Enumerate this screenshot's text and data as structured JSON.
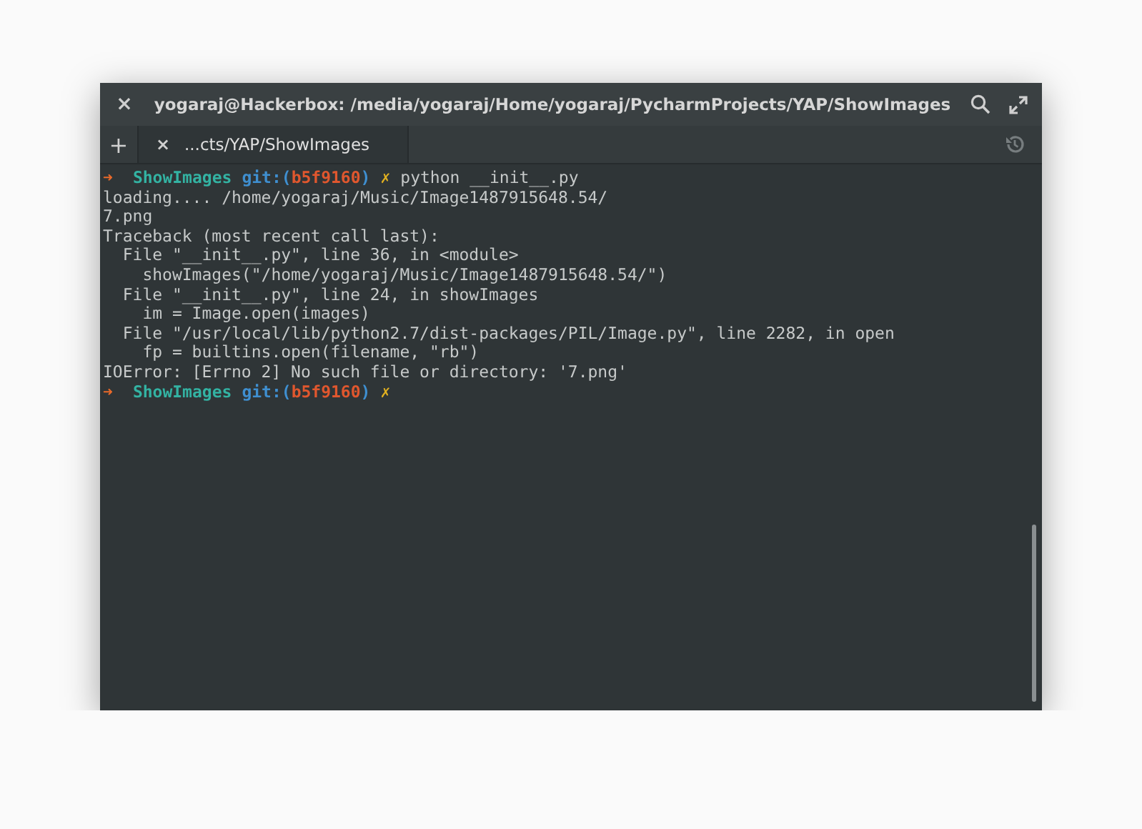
{
  "window": {
    "title": "yogaraj@Hackerbox: /media/yogaraj/Home/yogaraj/PycharmProjects/YAP/ShowImages",
    "close": "×"
  },
  "tabs": [
    {
      "label": "...cts/YAP/ShowImages",
      "close": "×",
      "selected": true
    }
  ],
  "new_tab": "+",
  "terminal": {
    "lines": [
      {
        "kind": "prompt",
        "arrow": "➜",
        "dir": "ShowImages",
        "git": "git:(",
        "branch": "b5f9160",
        "git_end": ")",
        "dirty": "✗",
        "command": "python __init__.py"
      },
      {
        "kind": "output",
        "text": "loading.... /home/yogaraj/Music/Image1487915648.54/"
      },
      {
        "kind": "output",
        "text": "7.png"
      },
      {
        "kind": "output",
        "text": "Traceback (most recent call last):"
      },
      {
        "kind": "output",
        "text": "  File \"__init__.py\", line 36, in <module>"
      },
      {
        "kind": "output",
        "text": "    showImages(\"/home/yogaraj/Music/Image1487915648.54/\")"
      },
      {
        "kind": "output",
        "text": "  File \"__init__.py\", line 24, in showImages"
      },
      {
        "kind": "output",
        "text": "    im = Image.open(images)"
      },
      {
        "kind": "output",
        "text": "  File \"/usr/local/lib/python2.7/dist-packages/PIL/Image.py\", line 2282, in open"
      },
      {
        "kind": "output",
        "text": "    fp = builtins.open(filename, \"rb\")"
      },
      {
        "kind": "output",
        "text": "IOError: [Errno 2] No such file or directory: '7.png'"
      },
      {
        "kind": "prompt",
        "arrow": "➜",
        "dir": "ShowImages",
        "git": "git:(",
        "branch": "b5f9160",
        "git_end": ")",
        "dirty": "✗"
      }
    ]
  }
}
